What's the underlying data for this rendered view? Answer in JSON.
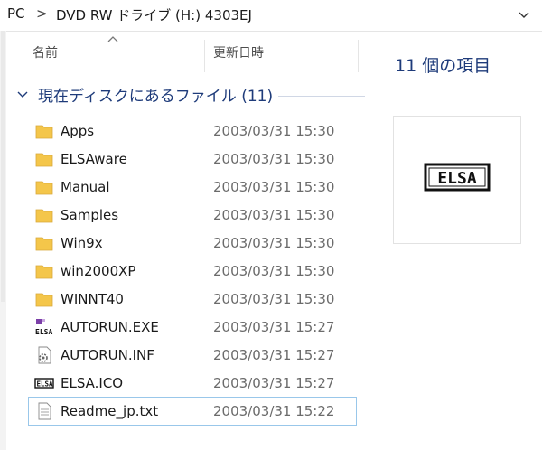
{
  "address": {
    "root": "PC",
    "separator": ">",
    "drive": "DVD RW ドライブ (H:) 4303EJ"
  },
  "columns": {
    "name": "名前",
    "modified": "更新日時"
  },
  "group": {
    "label": "現在ディスクにあるファイル (11)"
  },
  "files": [
    {
      "name": "Apps",
      "date": "2003/03/31 15:30",
      "icon": "folder-icon"
    },
    {
      "name": "ELSAware",
      "date": "2003/03/31 15:30",
      "icon": "folder-icon"
    },
    {
      "name": "Manual",
      "date": "2003/03/31 15:30",
      "icon": "folder-icon"
    },
    {
      "name": "Samples",
      "date": "2003/03/31 15:30",
      "icon": "folder-icon"
    },
    {
      "name": "Win9x",
      "date": "2003/03/31 15:30",
      "icon": "folder-icon"
    },
    {
      "name": "win2000XP",
      "date": "2003/03/31 15:30",
      "icon": "folder-icon"
    },
    {
      "name": "WINNT40",
      "date": "2003/03/31 15:30",
      "icon": "folder-icon"
    },
    {
      "name": "AUTORUN.EXE",
      "date": "2003/03/31 15:27",
      "icon": "elsa-exe-icon"
    },
    {
      "name": "AUTORUN.INF",
      "date": "2003/03/31 15:27",
      "icon": "settings-file-icon"
    },
    {
      "name": "ELSA.ICO",
      "date": "2003/03/31 15:27",
      "icon": "elsa-logo-icon"
    },
    {
      "name": "Readme_jp.txt",
      "date": "2003/03/31 15:22",
      "icon": "text-file-icon"
    }
  ],
  "details": {
    "count": "11 個の項目",
    "preview_logo": "ELSA"
  },
  "colors": {
    "accent": "#1e3b7a",
    "folder": "#f4c64a",
    "focus": "#99c7ea"
  }
}
